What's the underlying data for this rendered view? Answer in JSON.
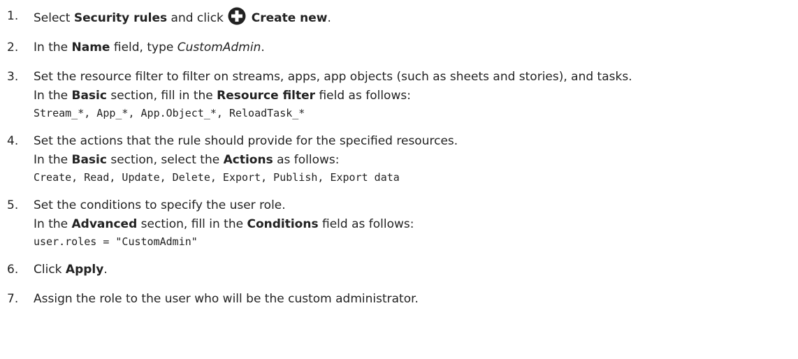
{
  "steps": [
    {
      "number": "1.",
      "pre": "Select ",
      "bold1": "Security rules",
      "mid": " and click ",
      "icon": "plus-circle-icon",
      "bold2": "Create new",
      "post": "."
    },
    {
      "number": "2.",
      "pre": "In the ",
      "bold": "Name",
      "mid": " field, type ",
      "italic": "CustomAdmin",
      "post": "."
    },
    {
      "number": "3.",
      "line1": "Set the resource filter to filter on streams, apps, app objects (such as sheets and stories), and tasks.",
      "line2_pre": "In the ",
      "line2_bold1": "Basic",
      "line2_mid": " section, fill in the ",
      "line2_bold2": "Resource filter",
      "line2_post": " field as follows:",
      "code": "Stream_*, App_*, App.Object_*, ReloadTask_*"
    },
    {
      "number": "4.",
      "line1": "Set the actions that the rule should provide for the specified resources.",
      "line2_pre": "In the ",
      "line2_bold1": "Basic",
      "line2_mid": " section, select the ",
      "line2_bold2": "Actions",
      "line2_post": " as follows:",
      "code": "Create, Read, Update, Delete, Export, Publish, Export data"
    },
    {
      "number": "5.",
      "line1": "Set the conditions to specify the user role.",
      "line2_pre": "In the ",
      "line2_bold1": "Advanced",
      "line2_mid": " section, fill in the ",
      "line2_bold2": "Conditions",
      "line2_post": " field as follows:",
      "code": "user.roles = \"CustomAdmin\""
    },
    {
      "number": "6.",
      "pre": "Click ",
      "bold": "Apply",
      "post": "."
    },
    {
      "number": "7.",
      "line1": "Assign the role to the user who will be the custom administrator."
    }
  ]
}
